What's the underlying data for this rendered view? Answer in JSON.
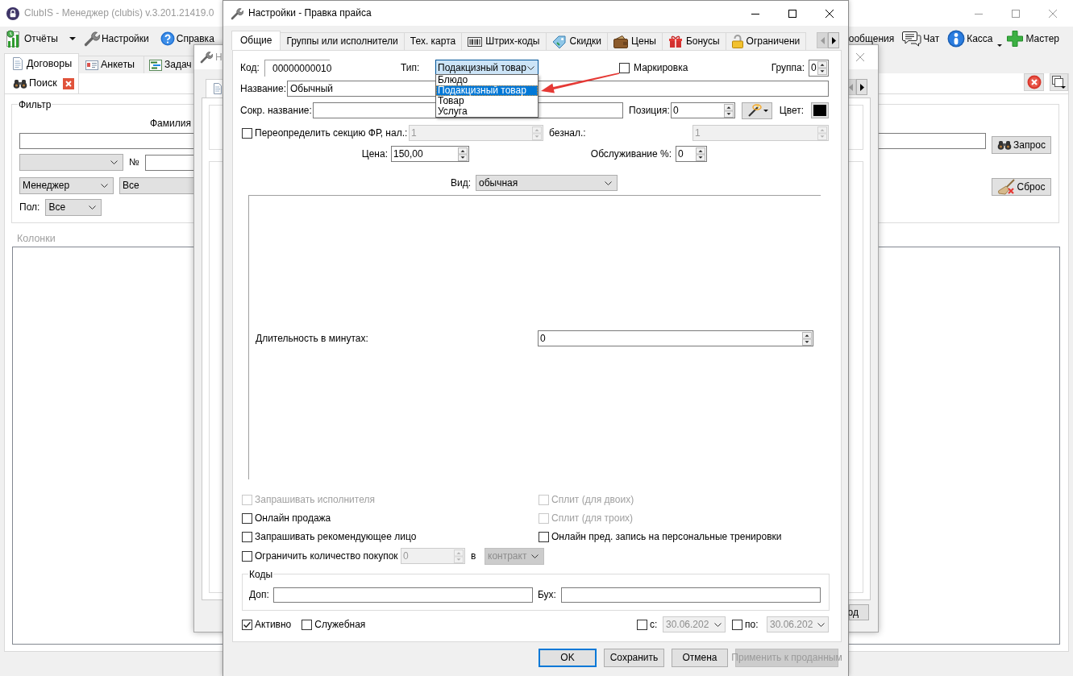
{
  "main_window": {
    "title": "ClubIS - Менеджер (clubis) v.3.201.21419.0",
    "toolbar": [
      {
        "label": "Отчёты",
        "menu": true
      },
      {
        "label": "Настройки",
        "menu": false
      },
      {
        "label": "Справка",
        "menu": false
      }
    ],
    "toolbar_right": [
      {
        "label": "ообщения",
        "menu": false
      },
      {
        "label": "Чат",
        "menu": false
      },
      {
        "label": "Касса",
        "menu": true
      },
      {
        "label": "Мастер",
        "menu": false
      }
    ],
    "tabs": [
      {
        "label": "Договоры",
        "selected": true
      },
      {
        "label": "Анкеты",
        "selected": false
      },
      {
        "label": "Задач",
        "selected": false
      }
    ],
    "search_tab": {
      "label": "Поиск"
    },
    "filter": {
      "title": "Фильтр",
      "surname_label": "Фамилия",
      "number_label": "№",
      "manager": "Менеджер",
      "status": "Все",
      "gender_label": "Пол:",
      "gender": "Все"
    },
    "query_button": "Запрос",
    "reset_button": "Сброс",
    "columns_label": "Колонки"
  },
  "back_window": {
    "title": "Н",
    "button": "од"
  },
  "dialog": {
    "title": "Настройки - Правка прайса",
    "tabs": [
      {
        "label": "Общие",
        "selected": true
      },
      {
        "label": "Группы или исполнители",
        "selected": false
      },
      {
        "label": "Тех. карта",
        "selected": false
      },
      {
        "label": "Штрих-коды",
        "selected": false
      },
      {
        "label": "Скидки",
        "selected": false
      },
      {
        "label": "Цены",
        "selected": false
      },
      {
        "label": "Бонусы",
        "selected": false
      },
      {
        "label": "Ограничени",
        "selected": false
      }
    ],
    "code": {
      "label": "Код:",
      "value": "00000000010"
    },
    "type": {
      "label": "Тип:",
      "value": "Подакцизный товар",
      "expanded": true,
      "options": [
        {
          "label": "Блюдо",
          "selected": false
        },
        {
          "label": "Подакцизный товар",
          "selected": true
        },
        {
          "label": "Товар",
          "selected": false
        },
        {
          "label": "Услуга",
          "selected": false
        }
      ]
    },
    "marking": {
      "label": "Маркировка",
      "checked": false
    },
    "group": {
      "label": "Группа:",
      "value": "0"
    },
    "name": {
      "label": "Название:",
      "value": "Обычный"
    },
    "short_name": {
      "label": "Сокр. название:"
    },
    "position": {
      "label": "Позиция:",
      "value": "0"
    },
    "color": {
      "label": "Цвет:",
      "color": "#000000"
    },
    "fr_section": {
      "label": "Переопределить секцию ФР, нал.:",
      "checked": false,
      "cash": {
        "value": "1",
        "disabled": true
      },
      "cashless_label": "безнал.:",
      "cashless": {
        "value": "1",
        "disabled": true
      }
    },
    "price": {
      "label": "Цена:",
      "value": "150,00"
    },
    "service": {
      "label": "Обслуживание %:",
      "value": "0"
    },
    "view": {
      "label": "Вид:",
      "value": "обычная"
    },
    "duration": {
      "label": "Длительность в минутах:",
      "value": "0"
    },
    "checkboxes": [
      {
        "label": "Запрашивать исполнителя",
        "checked": false,
        "disabled": true
      },
      {
        "label": "Сплит (для двоих)",
        "checked": false,
        "disabled": true
      },
      {
        "label": "Онлайн продажа",
        "checked": false,
        "disabled": false
      },
      {
        "label": "Сплит (для троих)",
        "checked": false,
        "disabled": true
      },
      {
        "label": "Запрашивать рекомендующее лицо",
        "checked": false,
        "disabled": false
      },
      {
        "label": "Онлайн пред. запись на персональные тренировки",
        "checked": false,
        "disabled": false
      }
    ],
    "limit": {
      "label": "Ограничить количество покупок",
      "checked": false,
      "count": {
        "value": "0",
        "disabled": true
      },
      "in_label": "в",
      "unit": {
        "value": "контракт",
        "disabled": true
      }
    },
    "codes": {
      "title": "Коды",
      "extra_label": "Доп:",
      "accounting_label": "Бух:"
    },
    "active": {
      "label": "Активно",
      "checked": true
    },
    "service_item": {
      "label": "Служебная",
      "checked": false
    },
    "date_from": {
      "label": "с:",
      "checked": false,
      "date": {
        "value": "30.06.202",
        "disabled": true
      }
    },
    "date_to": {
      "label": "по:",
      "checked": false,
      "date": {
        "value": "30.06.202",
        "disabled": true
      }
    },
    "buttons": [
      {
        "label": "OK",
        "focused": true,
        "disabled": false
      },
      {
        "label": "Сохранить",
        "focused": false,
        "disabled": false
      },
      {
        "label": "Отмена",
        "focused": false,
        "disabled": false
      },
      {
        "label": "Применить к проданным",
        "focused": false,
        "disabled": true
      }
    ]
  }
}
